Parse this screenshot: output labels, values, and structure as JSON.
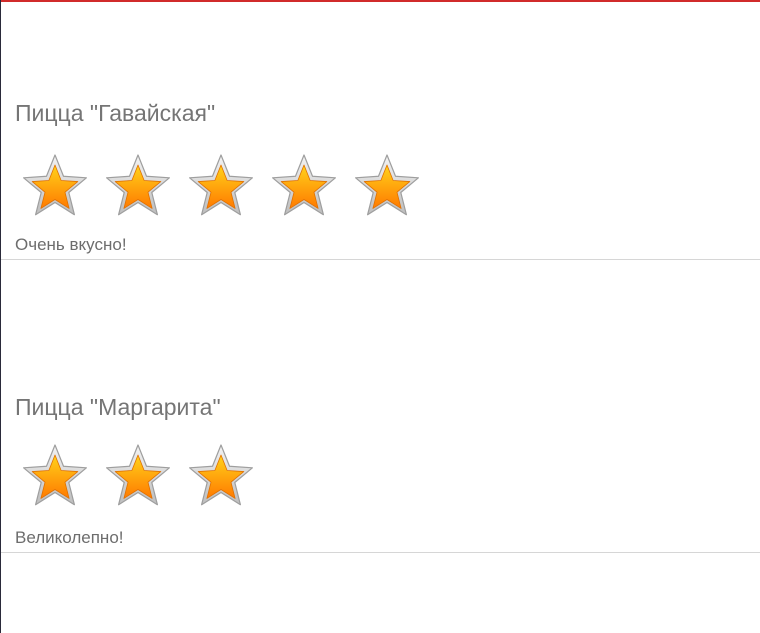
{
  "colors": {
    "top_accent": "#d12b2b",
    "text_title": "#757575",
    "text_comment": "#6d6d6d",
    "divider": "#d6d6d6",
    "star_fill_top": "#ffd21a",
    "star_fill_bottom": "#ff7a00",
    "star_outline": "#bdbdbd"
  },
  "list": {
    "items": [
      {
        "title": "Пицца \"Гавайская\"",
        "rating": 5,
        "comment": "Очень вкусно!"
      },
      {
        "title": "Пицца \"Маргарита\"",
        "rating": 3,
        "comment": "Великолепно!"
      }
    ]
  },
  "icons": {
    "star": "star-icon"
  }
}
